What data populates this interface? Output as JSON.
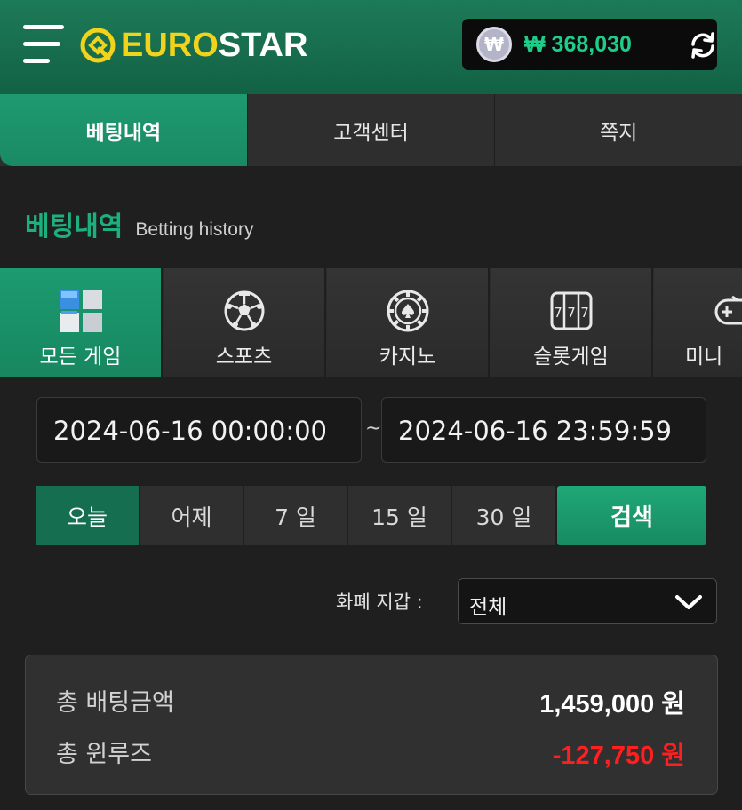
{
  "header": {
    "logo_euro": "EURO",
    "logo_star": "STAR",
    "currency_symbol": "₩",
    "balance": "₩ 368,030",
    "colors": {
      "header_green": "#1d7a58",
      "balance_green": "#1fcc8a",
      "logo_yellow": "#f2d31b"
    }
  },
  "top_tabs": [
    {
      "label": "베팅내역",
      "active": true
    },
    {
      "label": "고객센터",
      "active": false
    },
    {
      "label": "쪽지",
      "active": false
    }
  ],
  "section": {
    "title": "베팅내역",
    "subtitle": "Betting history"
  },
  "categories": [
    {
      "label": "모든 게임",
      "icon": "all-games-cubes-icon",
      "active": true
    },
    {
      "label": "스포츠",
      "icon": "soccer-ball-icon",
      "active": false
    },
    {
      "label": "카지노",
      "icon": "casino-chip-icon",
      "active": false
    },
    {
      "label": "슬롯게임",
      "icon": "slot-machine-icon",
      "active": false
    },
    {
      "label": "미니",
      "icon": "gamepad-icon",
      "active": false
    }
  ],
  "date_range": {
    "from": "2024-06-16 00:00:00",
    "separator": "~",
    "to": "2024-06-16 23:59:59"
  },
  "periods": [
    {
      "label": "오늘",
      "active": true
    },
    {
      "label": "어제",
      "active": false
    },
    {
      "label": "7 일",
      "active": false
    },
    {
      "label": "15 일",
      "active": false
    },
    {
      "label": "30 일",
      "active": false
    }
  ],
  "search_label": "검색",
  "currency_filter": {
    "label": "화폐 지갑 :",
    "selected": "전체"
  },
  "summary": {
    "total_bet_label": "총 배팅금액",
    "total_bet_value": "1,459,000 원",
    "total_winloss_label": "총 윈루즈",
    "total_winloss_value": "-127,750 원",
    "colors": {
      "negative": "#ff1f1f"
    }
  }
}
